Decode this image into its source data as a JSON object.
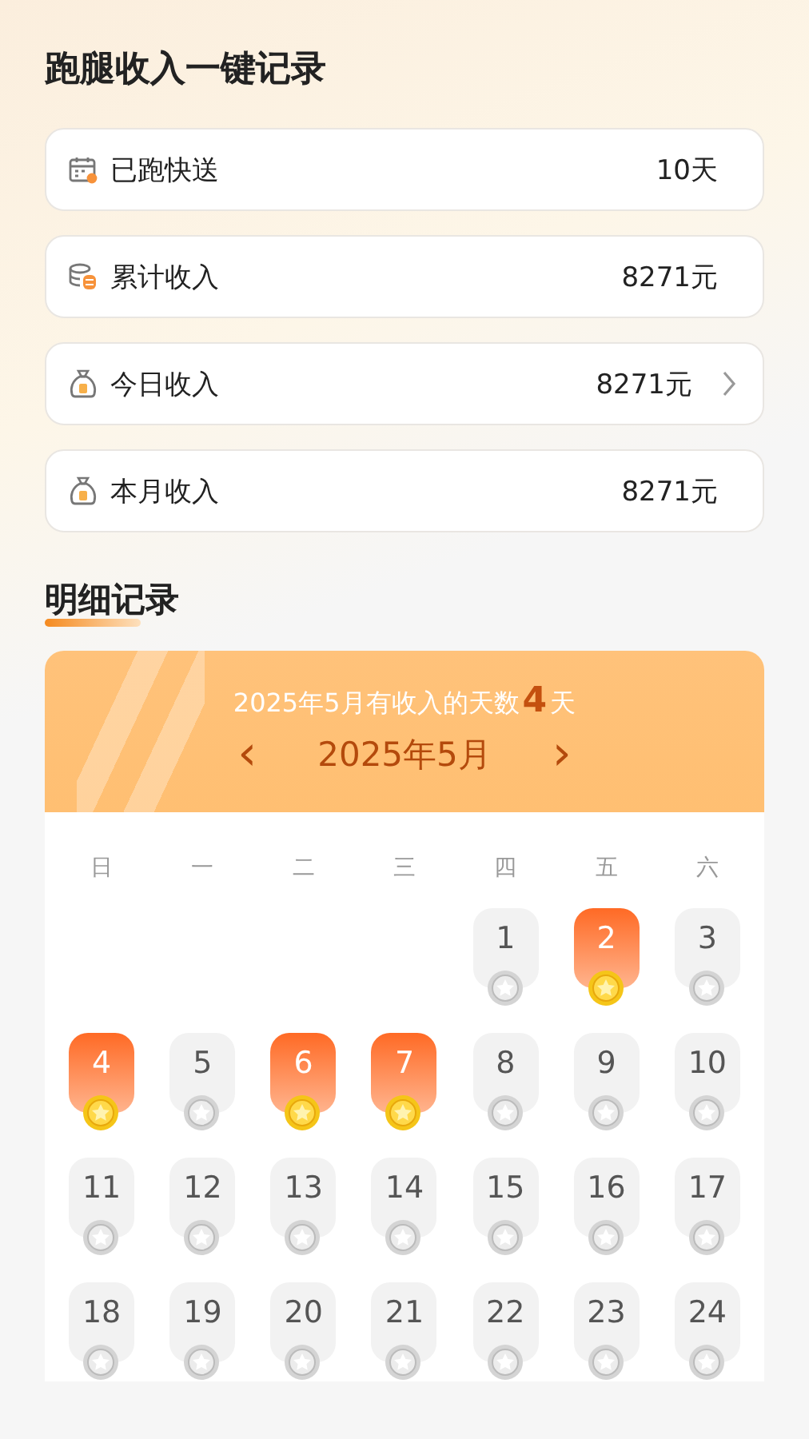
{
  "title": "跑腿收入一键记录",
  "stats": [
    {
      "kind": "calendar",
      "label": "已跑快送",
      "value": "10天",
      "chevron": false
    },
    {
      "kind": "coins",
      "label": "累计收入",
      "value": "8271元",
      "chevron": false
    },
    {
      "kind": "bag",
      "label": "今日收入",
      "value": "8271元",
      "chevron": true
    },
    {
      "kind": "bag",
      "label": "本月收入",
      "value": "8271元",
      "chevron": false
    }
  ],
  "section_title": "明细记录",
  "calendar": {
    "summary_prefix": "2025年5月有收入的天数",
    "summary_count": "4",
    "summary_suffix": "天",
    "prev": "‹",
    "month": "2025年5月",
    "next": "›",
    "weekdays": [
      "日",
      "一",
      "二",
      "三",
      "四",
      "五",
      "六"
    ],
    "days": [
      {
        "kind": "blank"
      },
      {
        "kind": "blank"
      },
      {
        "kind": "blank"
      },
      {
        "kind": "blank"
      },
      {
        "kind": "day",
        "label": "1",
        "earned": false
      },
      {
        "kind": "day",
        "label": "2",
        "earned": true
      },
      {
        "kind": "day",
        "label": "3",
        "earned": false
      },
      {
        "kind": "day",
        "label": "4",
        "earned": true
      },
      {
        "kind": "day",
        "label": "5",
        "earned": false
      },
      {
        "kind": "day",
        "label": "6",
        "earned": true
      },
      {
        "kind": "day",
        "label": "7",
        "earned": true
      },
      {
        "kind": "day",
        "label": "8",
        "earned": false
      },
      {
        "kind": "day",
        "label": "9",
        "earned": false
      },
      {
        "kind": "day",
        "label": "10",
        "earned": false
      },
      {
        "kind": "day",
        "label": "11",
        "earned": false
      },
      {
        "kind": "day",
        "label": "12",
        "earned": false
      },
      {
        "kind": "day",
        "label": "13",
        "earned": false
      },
      {
        "kind": "day",
        "label": "14",
        "earned": false
      },
      {
        "kind": "day",
        "label": "15",
        "earned": false
      },
      {
        "kind": "day",
        "label": "16",
        "earned": false
      },
      {
        "kind": "day",
        "label": "17",
        "earned": false
      },
      {
        "kind": "day",
        "label": "18",
        "earned": false
      },
      {
        "kind": "day",
        "label": "19",
        "earned": false
      },
      {
        "kind": "day",
        "label": "20",
        "earned": false
      },
      {
        "kind": "day",
        "label": "21",
        "earned": false
      },
      {
        "kind": "day",
        "label": "22",
        "earned": false
      },
      {
        "kind": "day",
        "label": "23",
        "earned": false
      },
      {
        "kind": "day",
        "label": "24",
        "earned": false
      }
    ]
  }
}
